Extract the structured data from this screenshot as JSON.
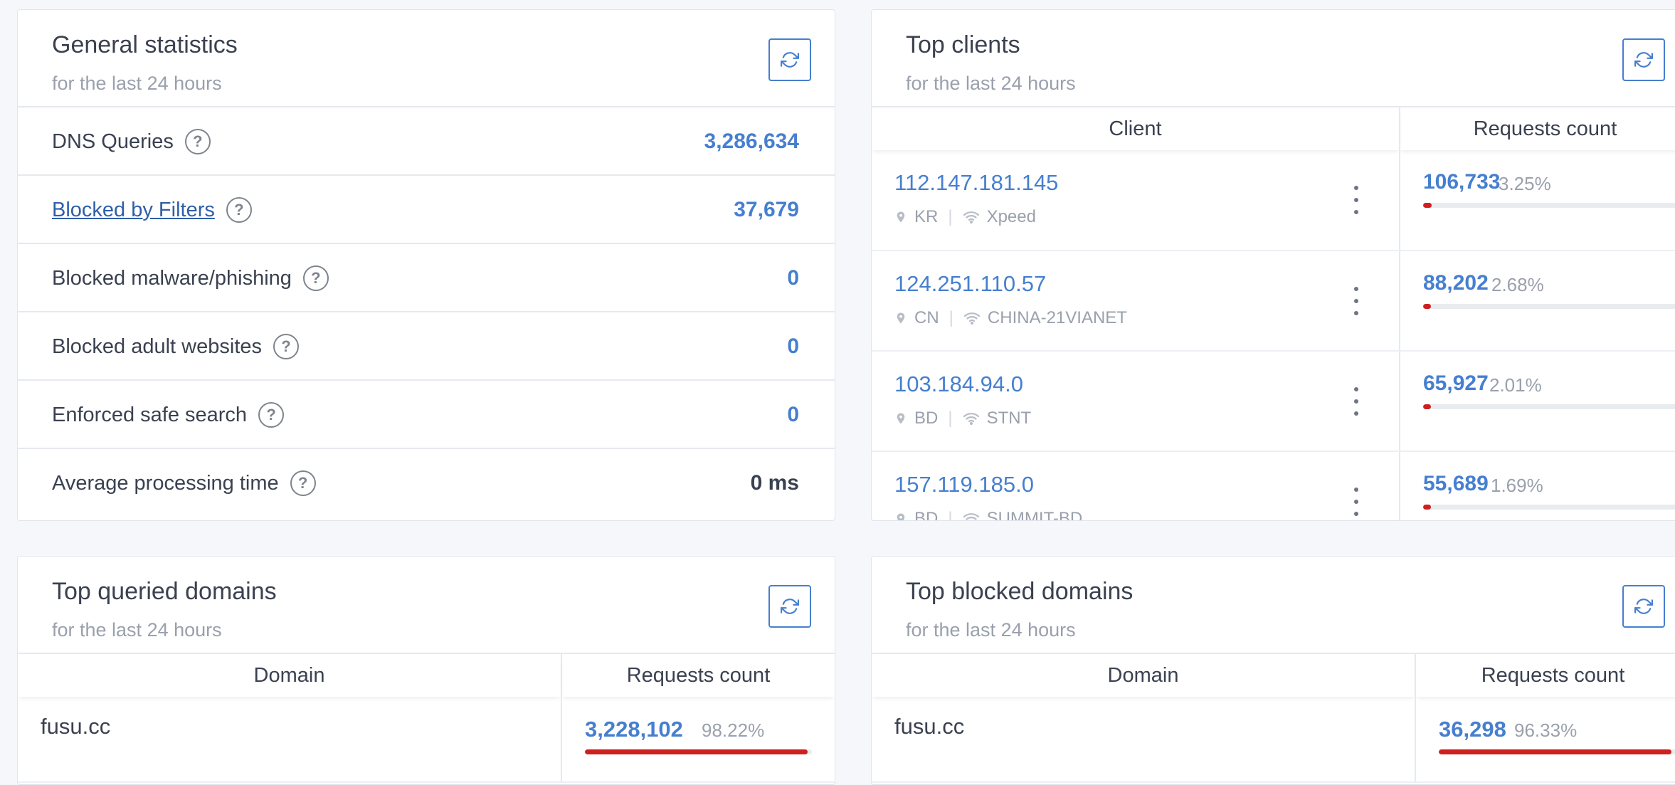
{
  "general": {
    "title": "General statistics",
    "subtitle": "for the last 24 hours",
    "rows": [
      {
        "label": "DNS Queries",
        "value": "3,286,634"
      },
      {
        "label": "Blocked by Filters",
        "value": "37,679"
      },
      {
        "label": "Blocked malware/phishing",
        "value": "0"
      },
      {
        "label": "Blocked adult websites",
        "value": "0"
      },
      {
        "label": "Enforced safe search",
        "value": "0"
      },
      {
        "label": "Average processing time",
        "value": "0 ms"
      }
    ]
  },
  "clients": {
    "title": "Top clients",
    "subtitle": "for the last 24 hours",
    "col_client": "Client",
    "col_count": "Requests count",
    "rows": [
      {
        "ip": "112.147.181.145",
        "country": "KR",
        "network": "Xpeed",
        "count": "106,733",
        "percent": "3.25%",
        "ratio": 0.0325
      },
      {
        "ip": "124.251.110.57",
        "country": "CN",
        "network": "CHINA-21VIANET",
        "count": "88,202",
        "percent": "2.68%",
        "ratio": 0.0268
      },
      {
        "ip": "103.184.94.0",
        "country": "BD",
        "network": "STNT",
        "count": "65,927",
        "percent": "2.01%",
        "ratio": 0.0201
      },
      {
        "ip": "157.119.185.0",
        "country": "BD",
        "network": "SUMMIT-BD",
        "count": "55,689",
        "percent": "1.69%",
        "ratio": 0.0169
      }
    ]
  },
  "queried": {
    "title": "Top queried domains",
    "subtitle": "for the last 24 hours",
    "col_domain": "Domain",
    "col_count": "Requests count",
    "rows": [
      {
        "domain": "fusu.cc",
        "count": "3,228,102",
        "percent": "98.22%",
        "ratio": 0.9822
      }
    ]
  },
  "blocked": {
    "title": "Top blocked domains",
    "subtitle": "for the last 24 hours",
    "col_domain": "Domain",
    "col_count": "Requests count",
    "rows": [
      {
        "domain": "fusu.cc",
        "count": "36,298",
        "percent": "96.33%",
        "ratio": 0.9633
      }
    ]
  },
  "icons": {
    "refresh": "refresh-icon",
    "help": "?",
    "location": "map-pin-icon",
    "network": "wifi-icon",
    "menu": "more-vertical-icon"
  },
  "colors": {
    "accent": "#467fcf",
    "bar": "#cd201f",
    "link": "#2f5fa8"
  }
}
